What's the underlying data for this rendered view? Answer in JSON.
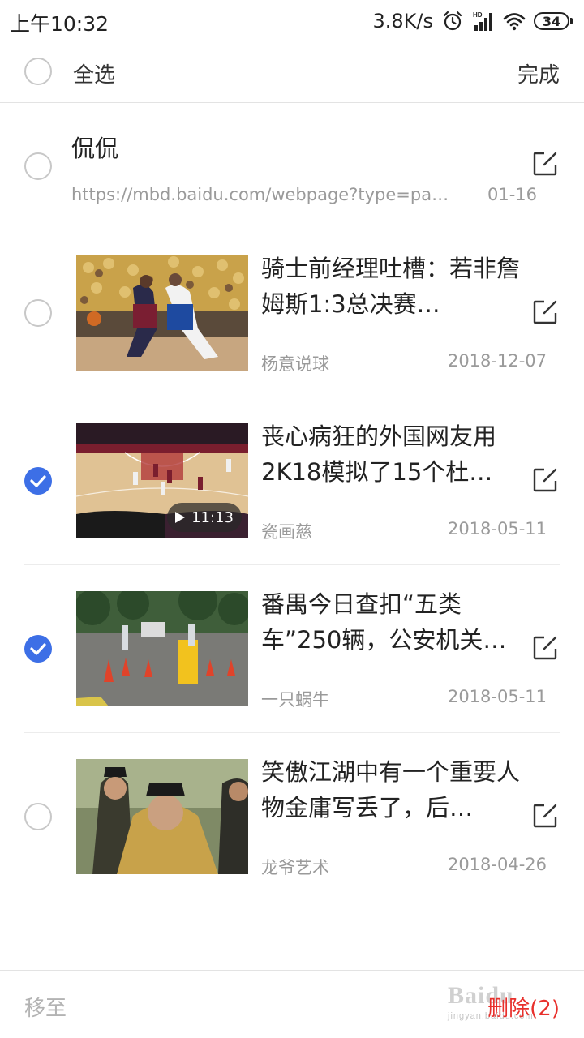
{
  "status_bar": {
    "time": "上午10:32",
    "net_speed": "3.8K/s",
    "signal_label": "HD",
    "battery": "34",
    "icons": [
      "alarm-icon",
      "signal-icon",
      "wifi-icon",
      "battery-icon"
    ]
  },
  "toolbar": {
    "select_all_label": "全选",
    "done_label": "完成"
  },
  "items": [
    {
      "type": "text",
      "title": "侃侃",
      "url": "https://mbd.baidu.com/webpage?type=page…",
      "date": "01-16",
      "checked": false
    },
    {
      "type": "media",
      "title": "骑士前经理吐槽：若非詹姆斯1:3总决赛…",
      "source": "杨意说球",
      "date": "2018-12-07",
      "checked": false,
      "thumbnail": "basketball-game-photo"
    },
    {
      "type": "media",
      "title": "丧心病狂的外国网友用2K18模拟了15个杜…",
      "source": "瓷画慈",
      "date": "2018-05-11",
      "checked": true,
      "thumbnail": "basketball-video-game-screenshot",
      "duration": "11:13"
    },
    {
      "type": "media",
      "title": "番禺今日查扣“五类车”250辆，公安机关…",
      "source": "一只蜗牛",
      "date": "2018-05-11",
      "checked": true,
      "thumbnail": "police-checkpoint-photo"
    },
    {
      "type": "media",
      "title": "笑傲江湖中有一个重要人物金庸写丢了，后…",
      "source": "龙爷艺术",
      "date": "2018-04-26",
      "checked": false,
      "thumbnail": "movie-still-photo"
    }
  ],
  "bottom_bar": {
    "move_label": "移至",
    "delete_label": "删除(2)"
  },
  "watermark": {
    "brand": "Baidu",
    "domain": "jingyan.baidu.com"
  },
  "colors": {
    "accent": "#3d6fe6",
    "delete": "#e8302c",
    "secondary_text": "#9a9a9a",
    "divider": "#ececec"
  }
}
